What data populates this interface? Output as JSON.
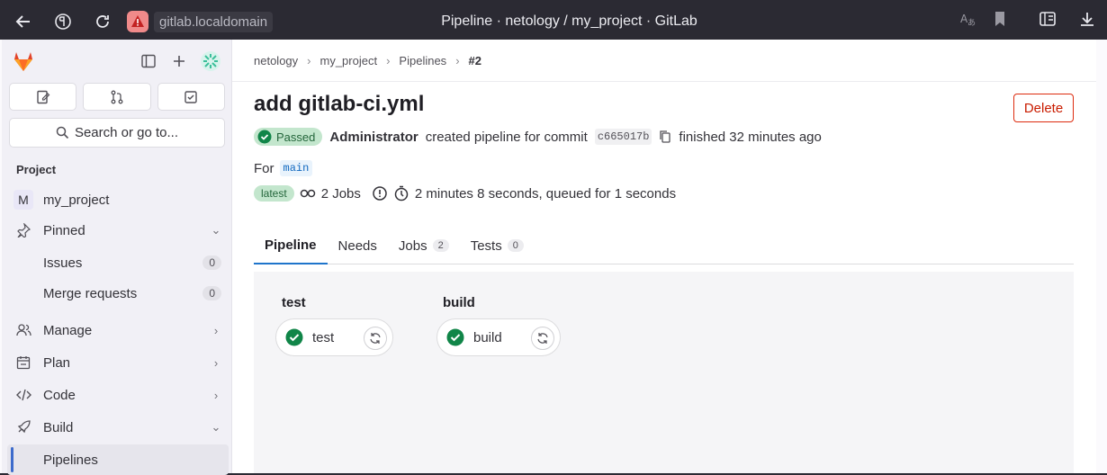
{
  "browser": {
    "url": "gitlab.localdomain",
    "tab_title": "Pipeline · netology / my_project · GitLab"
  },
  "sidebar": {
    "search_label": "Search or go to...",
    "section_label": "Project",
    "project_initial": "M",
    "project_name": "my_project",
    "pinned_label": "Pinned",
    "issues_label": "Issues",
    "issues_count": "0",
    "merge_requests_label": "Merge requests",
    "merge_requests_count": "0",
    "manage_label": "Manage",
    "plan_label": "Plan",
    "code_label": "Code",
    "build_label": "Build",
    "pipelines_label": "Pipelines"
  },
  "breadcrumb": {
    "items": [
      "netology",
      "my_project",
      "Pipelines"
    ],
    "current": "#2"
  },
  "pipeline": {
    "title": "add gitlab-ci.yml",
    "delete_label": "Delete",
    "status": "Passed",
    "author": "Administrator",
    "action_text": "created pipeline for commit",
    "commit_sha": "c665017b",
    "finished_text": "finished 32 minutes ago",
    "for_label": "For",
    "branch": "main",
    "latest_label": "latest",
    "jobs_text": "2 Jobs",
    "duration_text": "2 minutes 8 seconds, queued for 1 seconds"
  },
  "tabs": [
    {
      "label": "Pipeline"
    },
    {
      "label": "Needs"
    },
    {
      "label": "Jobs",
      "count": "2"
    },
    {
      "label": "Tests",
      "count": "0"
    }
  ],
  "stages": [
    {
      "name": "test",
      "job": "test",
      "status": "success"
    },
    {
      "name": "build",
      "job": "build",
      "status": "success"
    }
  ],
  "colors": {
    "success": "#108548",
    "accent": "#1f75cb",
    "danger": "#dd2b0e"
  }
}
